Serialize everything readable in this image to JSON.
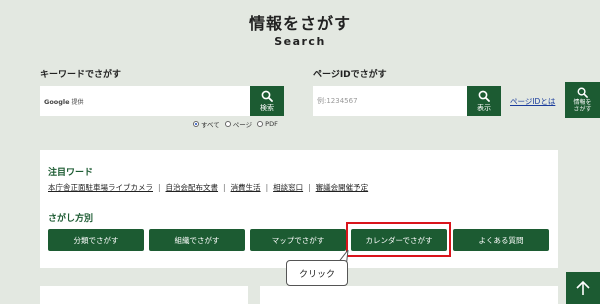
{
  "header": {
    "title": "情報をさがす",
    "subtitle": "Search"
  },
  "keyword_search": {
    "label": "キーワードでさがす",
    "google_prefix": "Google",
    "google_suffix": "提供",
    "button_label": "検索",
    "scope_options": [
      {
        "label": "すべて",
        "selected": true
      },
      {
        "label": "ページ",
        "selected": false
      },
      {
        "label": "PDF",
        "selected": false
      }
    ]
  },
  "page_id_search": {
    "label": "ページIDでさがす",
    "placeholder": "例:1234567",
    "button_label": "表示",
    "help_link": "ページIDとは"
  },
  "side_button": {
    "label_line1": "情報を",
    "label_line2": "さがす"
  },
  "featured_words": {
    "heading": "注目ワード",
    "items": [
      "本庁舎正面駐車場ライブカメラ",
      "自治会配布文書",
      "消費生活",
      "相談窓口",
      "審議会開催予定"
    ]
  },
  "search_methods": {
    "heading": "さがし方別",
    "buttons": [
      "分類でさがす",
      "組織でさがす",
      "マップでさがす",
      "カレンダーでさがす",
      "よくある質問"
    ],
    "highlighted_index": 3
  },
  "annotation": {
    "callout_text": "クリック"
  },
  "colors": {
    "brand_green": "#1c5b32",
    "highlight_red": "#d9141b",
    "background": "#e3e8e1"
  },
  "icons": {
    "search": "search-icon",
    "scroll_top": "arrow-up-icon"
  }
}
